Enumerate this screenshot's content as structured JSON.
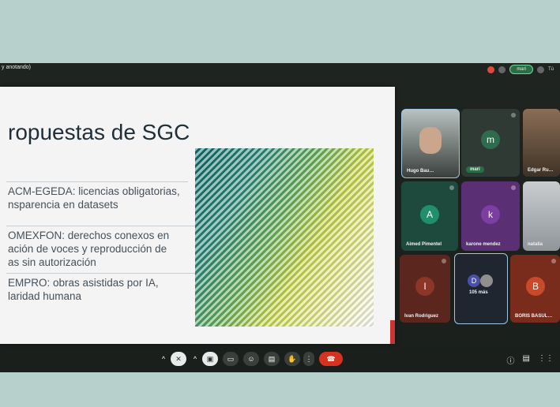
{
  "window": {
    "title": "y anotando)"
  },
  "top_bar": {
    "pill_label": "mari",
    "small_label": "Tú"
  },
  "slide": {
    "title": "ropuestas de SGC",
    "bullets": [
      "ACM-EGEDA: licencias obligatorias,\nnsparencia en datasets",
      "OMEXFON: derechos conexos en\nación de voces y reproducción de\nas sin autorización",
      "EMPRO: obras asistidas por IA,\nlaridad humana"
    ]
  },
  "participants": [
    {
      "name": "Hugo Bau…",
      "initial": "",
      "color": "#3a3f3c",
      "type": "video"
    },
    {
      "name": "mari",
      "initial": "m",
      "color": "#2f6b4d",
      "type": "avatar"
    },
    {
      "name": "Edgar Ru…",
      "initial": "",
      "color": "#6b5a45",
      "type": "video"
    },
    {
      "name": "Aimed Pimentel",
      "initial": "A",
      "color": "#1f8f6c",
      "type": "avatar"
    },
    {
      "name": "karone mendez",
      "initial": "k",
      "color": "#7a3fa0",
      "type": "avatar"
    },
    {
      "name": "natalia",
      "initial": "",
      "color": "#b7bcc0",
      "type": "video"
    },
    {
      "name": "Ivan Rodriguez",
      "initial": "I",
      "color": "#8d3526",
      "type": "avatar"
    },
    {
      "name": "105 más",
      "initial": "D",
      "color": "#1f2630",
      "type": "group"
    },
    {
      "name": "BORIS BASUL…",
      "initial": "B",
      "color": "#c84a2a",
      "type": "avatar"
    }
  ],
  "controls": [
    {
      "icon": "chevron-up-icon"
    },
    {
      "icon": "mic-off-icon"
    },
    {
      "icon": "chevron-up-icon"
    },
    {
      "icon": "camera-off-icon"
    },
    {
      "icon": "present-icon"
    },
    {
      "icon": "emoji-icon"
    },
    {
      "icon": "captions-icon"
    },
    {
      "icon": "raise-hand-icon"
    },
    {
      "icon": "more-icon"
    },
    {
      "icon": "end-call-icon"
    }
  ],
  "right_icons": [
    "info-icon",
    "chat-icon",
    "apps-icon"
  ]
}
